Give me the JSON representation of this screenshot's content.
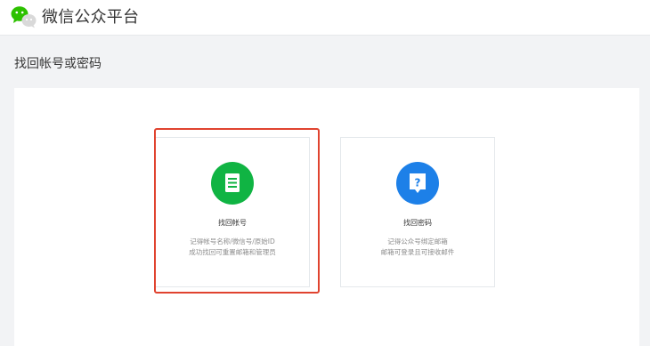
{
  "header": {
    "brand_title": "微信公众平台",
    "logo_icon": "wechat-logo-icon"
  },
  "page": {
    "title": "找回帐号或密码"
  },
  "options": [
    {
      "title": "找回帐号",
      "icon": "document-icon",
      "icon_color": "#10b443",
      "desc_line1": "记得帐号名称/微信号/原始ID",
      "desc_line2": "成功找回可重置邮箱和管理员",
      "highlighted": true
    },
    {
      "title": "找回密码",
      "icon": "question-icon",
      "icon_color": "#1d80e8",
      "desc_line1": "记得公众号绑定邮箱",
      "desc_line2": "邮箱可登录且可接收邮件",
      "highlighted": false
    }
  ],
  "colors": {
    "highlight": "#e0432f",
    "background": "#f2f3f5"
  }
}
